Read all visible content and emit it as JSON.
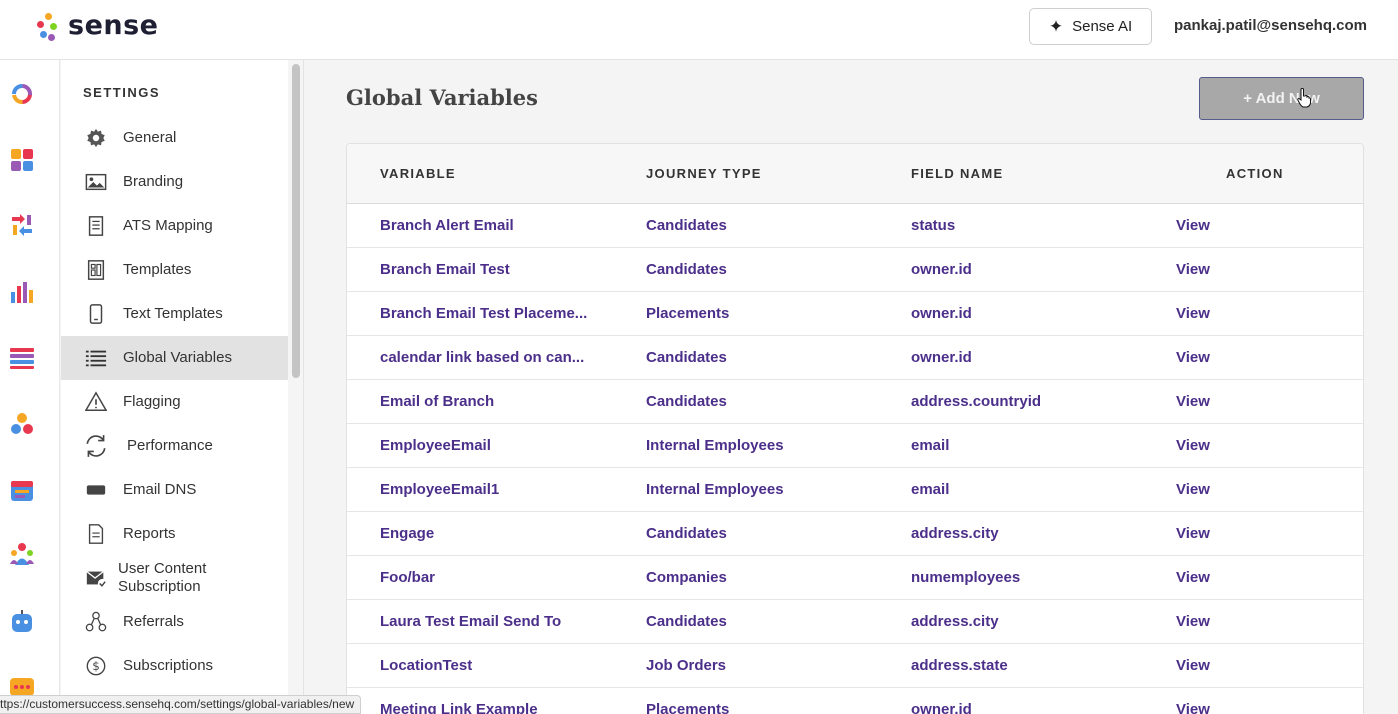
{
  "app": {
    "logo_text": "sense",
    "ai_button_label": "Sense AI",
    "user_email": "pankaj.patil@sensehq.com"
  },
  "rail_icons": [
    "logo-ring-icon",
    "grid-apps-icon",
    "sync-arrows-icon",
    "bar-chart-icon",
    "list-stack-icon",
    "people-dots-icon",
    "calendar-icon",
    "team-icon",
    "chatbot-icon",
    "chat-bubble-icon"
  ],
  "sidebar": {
    "heading": "SETTINGS",
    "items": [
      {
        "label": "General",
        "icon": "gear-icon"
      },
      {
        "label": "Branding",
        "icon": "image-icon"
      },
      {
        "label": "ATS Mapping",
        "icon": "document-icon"
      },
      {
        "label": "Templates",
        "icon": "template-icon"
      },
      {
        "label": "Text Templates",
        "icon": "phone-icon"
      },
      {
        "label": "Global Variables",
        "icon": "list-icon",
        "active": true
      },
      {
        "label": "Flagging",
        "icon": "warning-icon"
      },
      {
        "label": "Performance",
        "icon": "refresh-icon"
      },
      {
        "label": "Email DNS",
        "icon": "dns-icon"
      },
      {
        "label": "Reports",
        "icon": "report-icon"
      },
      {
        "label": "User Content Subscription",
        "icon": "mail-check-icon"
      },
      {
        "label": "Referrals",
        "icon": "referral-icon"
      },
      {
        "label": "Subscriptions",
        "icon": "dollar-icon"
      }
    ]
  },
  "main": {
    "title": "Global Variables",
    "add_button_label": "+ Add New",
    "table": {
      "headers": [
        "VARIABLE",
        "JOURNEY TYPE",
        "FIELD NAME",
        "ACTION"
      ],
      "rows": [
        {
          "variable": "Branch Alert Email",
          "journey": "Candidates",
          "field": "status",
          "action": "View"
        },
        {
          "variable": "Branch Email Test",
          "journey": "Candidates",
          "field": "owner.id",
          "action": "View"
        },
        {
          "variable": "Branch Email Test Placeme...",
          "journey": "Placements",
          "field": "owner.id",
          "action": "View"
        },
        {
          "variable": "calendar link based on can...",
          "journey": "Candidates",
          "field": "owner.id",
          "action": "View"
        },
        {
          "variable": "Email of Branch",
          "journey": "Candidates",
          "field": "address.countryid",
          "action": "View"
        },
        {
          "variable": "EmployeeEmail",
          "journey": "Internal Employees",
          "field": "email",
          "action": "View"
        },
        {
          "variable": "EmployeeEmail1",
          "journey": "Internal Employees",
          "field": "email",
          "action": "View"
        },
        {
          "variable": "Engage",
          "journey": "Candidates",
          "field": "address.city",
          "action": "View"
        },
        {
          "variable": "Foo/bar",
          "journey": "Companies",
          "field": "numemployees",
          "action": "View"
        },
        {
          "variable": "Laura Test Email Send To",
          "journey": "Candidates",
          "field": "address.city",
          "action": "View"
        },
        {
          "variable": "LocationTest",
          "journey": "Job Orders",
          "field": "address.state",
          "action": "View"
        },
        {
          "variable": "Meeting Link Example",
          "journey": "Placements",
          "field": "owner.id",
          "action": "View"
        }
      ]
    }
  },
  "status_url": "ttps://customersuccess.sensehq.com/settings/global-variables/new",
  "colors": {
    "link": "#4b2f8a",
    "active_bg": "#e2e2e2",
    "add_button_bg": "#a8a8a8"
  }
}
